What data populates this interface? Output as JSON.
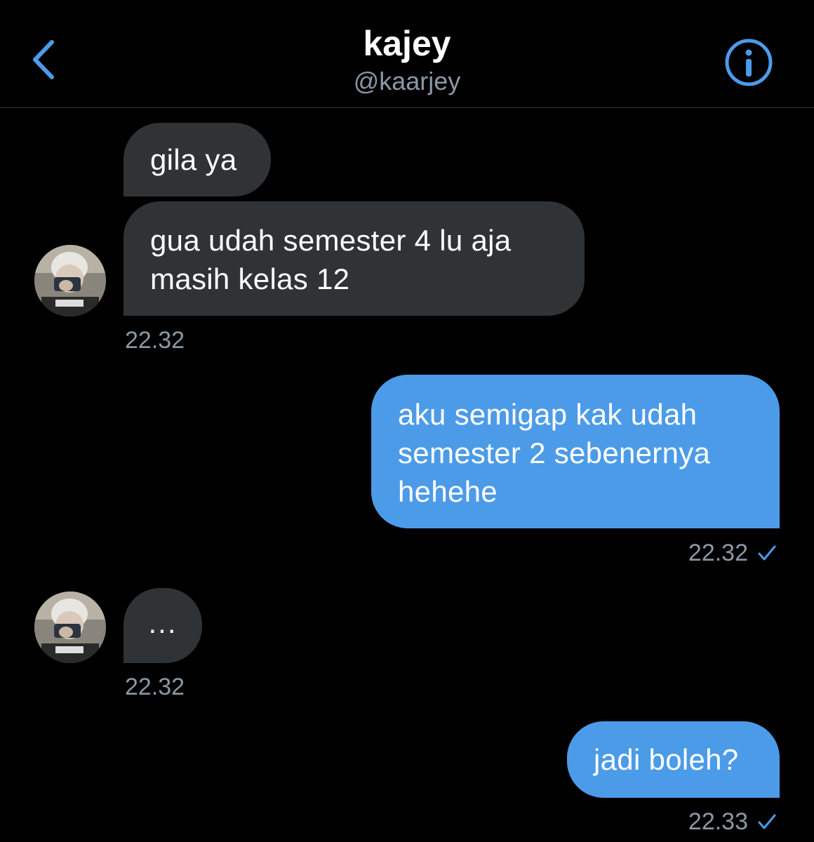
{
  "header": {
    "title": "kajey",
    "handle": "@kaarjey",
    "back_icon": "chevron-left-icon",
    "info_icon": "info-circle-icon",
    "accent_color": "#4c9be8"
  },
  "messages": [
    {
      "direction": "incoming",
      "text": "gila ya"
    },
    {
      "direction": "incoming",
      "lines": [
        "gua udah semester 4 lu aja",
        "masih kelas 12"
      ],
      "time": "22.32"
    },
    {
      "direction": "outgoing",
      "lines": [
        "aku semigap kak udah",
        "semester 2 sebenernya",
        "hehehe"
      ],
      "time": "22.32",
      "status_icon": "check-icon"
    },
    {
      "direction": "incoming",
      "text": "...",
      "time": "22.32"
    },
    {
      "direction": "outgoing",
      "text": "jadi boleh?",
      "time": "22.33",
      "status_icon": "check-icon"
    }
  ],
  "colors": {
    "incoming_bubble": "#2f3336",
    "outgoing_bubble": "#4c9be8",
    "timestamp": "#8b98a5",
    "background": "#000000"
  }
}
